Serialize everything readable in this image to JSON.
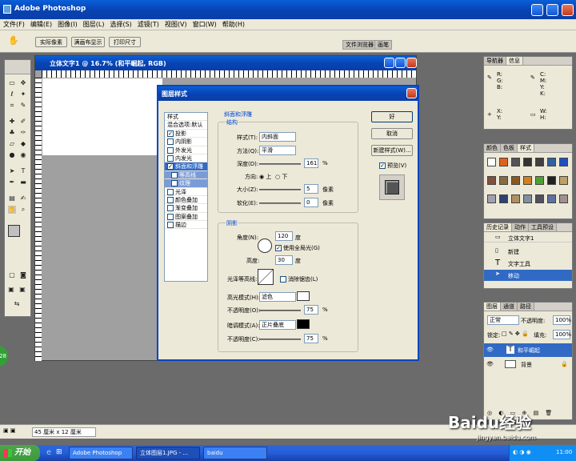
{
  "app": {
    "title": "Adobe Photoshop"
  },
  "menu": [
    "文件(F)",
    "编辑(E)",
    "图像(I)",
    "图层(L)",
    "选择(S)",
    "滤镜(T)",
    "视图(V)",
    "窗口(W)",
    "帮助(H)"
  ],
  "options": {
    "btn1": "实际像素",
    "btn2": "满画布显示",
    "btn3": "打印尺寸",
    "tab1": "文件浏览器",
    "tab2": "画笔"
  },
  "doc": {
    "title": "立体文字1 @ 16.7% (和平崛起, RGB)"
  },
  "status": {
    "size": "45 厘米 x 12 厘米"
  },
  "dialog": {
    "title": "图层样式",
    "styles": [
      "样式",
      "混合选项:默认",
      "投影",
      "内阴影",
      "外发光",
      "内发光",
      "斜面和浮雕",
      "等高线",
      "纹理",
      "光泽",
      "颜色叠加",
      "渐变叠加",
      "图案叠加",
      "描边"
    ],
    "checked": {
      "投影": true,
      "斜面和浮雕": true
    },
    "section_title": "斜面和浮雕",
    "structure": "结构",
    "style_label": "样式(T):",
    "style_value": "内斜面",
    "method_label": "方法(Q):",
    "method_value": "平滑",
    "depth_label": "深度(D):",
    "depth_value": "161",
    "percent": "%",
    "direction_label": "方向:",
    "dir_up": "上",
    "dir_down": "下",
    "size_label": "大小(Z):",
    "size_value": "5",
    "px": "像素",
    "soften_label": "软化(E):",
    "soften_value": "0",
    "shading": "阴影",
    "angle_label": "角度(N):",
    "angle_value": "120",
    "deg": "度",
    "global_light": "使用全局光(G)",
    "altitude_label": "高度:",
    "altitude_value": "30",
    "gloss_label": "光泽等高线:",
    "antialias": "消除锯齿(L)",
    "hl_mode_label": "高光模式(H):",
    "hl_mode_value": "滤色",
    "opacity_label": "不透明度(O):",
    "hl_opacity": "75",
    "sh_mode_label": "暗调模式(A):",
    "sh_mode_value": "正片叠底",
    "opacity_label2": "不透明度(C):",
    "sh_opacity": "75",
    "ok": "好",
    "cancel": "取消",
    "new_style": "新建样式(W)...",
    "preview": "预览(V)"
  },
  "navinfo": {
    "tab1": "导航器",
    "tab2": "信息",
    "r": "R:",
    "g": "G:",
    "b": "B:",
    "c": "C:",
    "m": "M:",
    "y": "Y:",
    "k": "K:",
    "x": "X:",
    "y2": "Y:",
    "w": "W:",
    "h": "H:"
  },
  "swatches": {
    "tabs": [
      "颜色",
      "色板",
      "样式"
    ]
  },
  "history": {
    "tabs": [
      "历史记录",
      "动作",
      "工具预设"
    ],
    "items": [
      "立体文字1",
      "新建",
      "文字工具",
      "移动"
    ]
  },
  "layers": {
    "tabs": [
      "图层",
      "通道",
      "路径"
    ],
    "blend": "正常",
    "opacity_label": "不透明度:",
    "opacity": "100%",
    "lock_label": "锁定:",
    "fill_label": "填充:",
    "fill": "100%",
    "items": [
      "和平崛起",
      "背景"
    ]
  },
  "taskbar": {
    "start": "开始",
    "tasks": [
      "Adobe Photoshop",
      "立体图层1.JPG - ...",
      "baidu"
    ],
    "clock": "11:00"
  },
  "watermark": "Baidu经验",
  "watermark_url": "jingyan.baidu.com",
  "badge": "28",
  "colors": {
    "accent": "#316ac5",
    "xp_blue": "#0a5fd8",
    "taskbar_green": "#3c9a3c"
  }
}
